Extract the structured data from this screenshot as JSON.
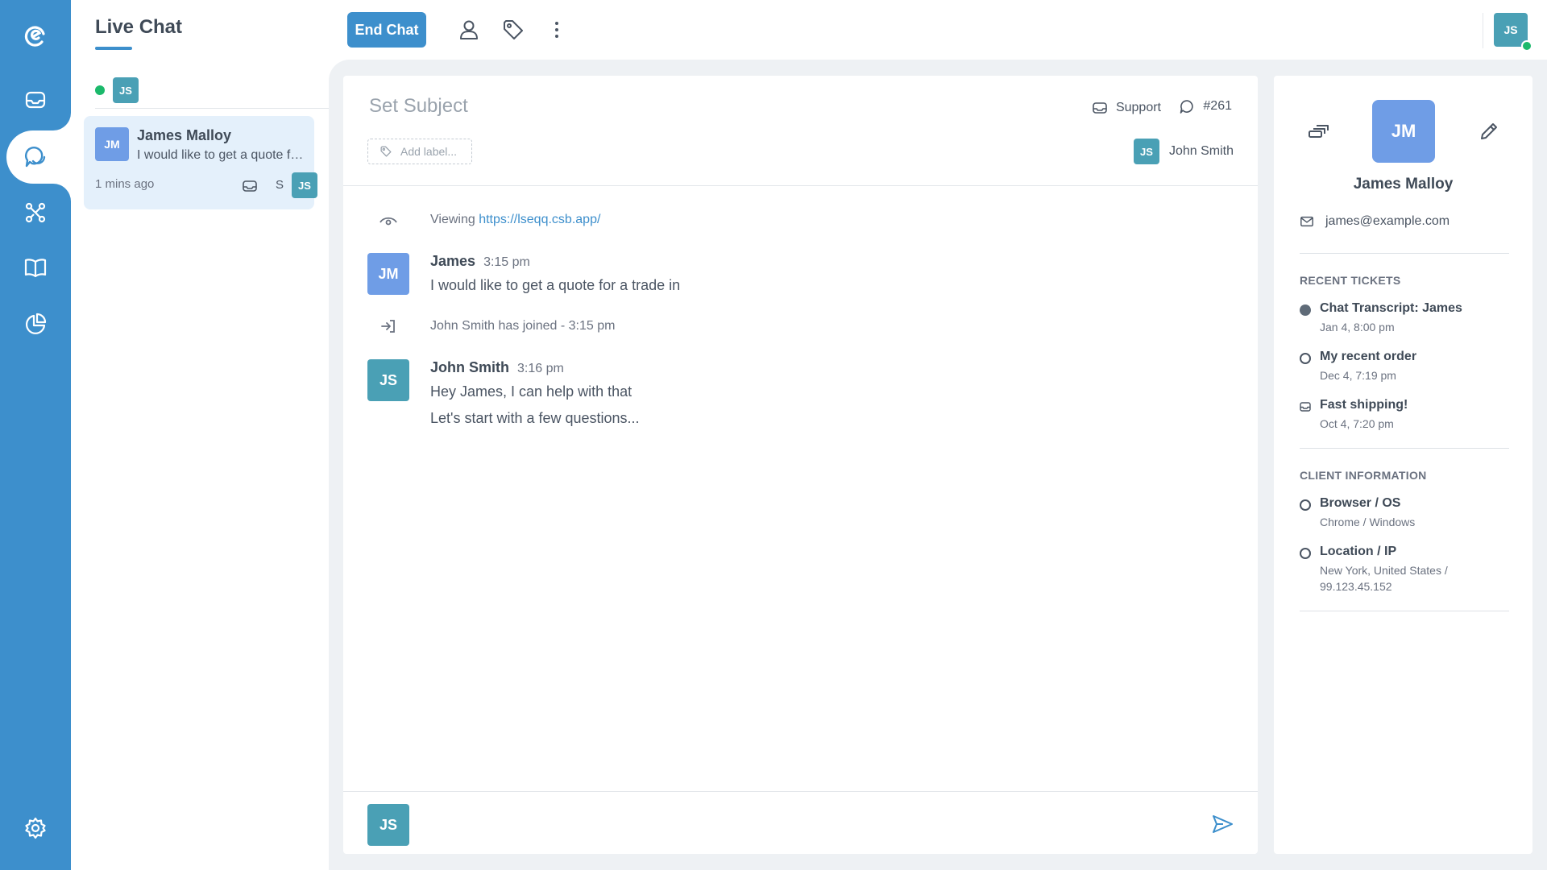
{
  "rail": {
    "items": [
      {
        "name": "logo-icon"
      },
      {
        "name": "inbox-icon"
      },
      {
        "name": "chat-icon"
      },
      {
        "name": "workflow-icon"
      },
      {
        "name": "knowledge-base-icon"
      },
      {
        "name": "reports-icon"
      },
      {
        "name": "settings-icon"
      }
    ],
    "accent": "#3d8fcc"
  },
  "chat_list": {
    "title": "Live Chat",
    "filter_agent_initials": "JS",
    "conversations": [
      {
        "initials": "JM",
        "name": "James Malloy",
        "preview": "I would like to get a quote for a trade in",
        "time": "1 mins ago",
        "inbox_letter": "S",
        "assignee_initials": "JS"
      }
    ]
  },
  "toolbar": {
    "end_chat_label": "End Chat",
    "current_user_initials": "JS"
  },
  "chat": {
    "subject_placeholder": "Set Subject",
    "add_label_text": "Add label...",
    "inbox_name": "Support",
    "ticket_number": "#261",
    "assignee_initials": "JS",
    "assignee_name": "John Smith",
    "viewing_prefix": "Viewing",
    "viewing_url": "https://lseqq.csb.app/",
    "messages": [
      {
        "initials": "JM",
        "author": "James",
        "time": "3:15 pm",
        "lines": [
          "I would like to get a quote for a trade in"
        ]
      },
      {
        "initials": "JS",
        "author": "John Smith",
        "time": "3:16 pm",
        "lines": [
          "Hey James, I can help with that",
          "Let's start with a few questions..."
        ]
      }
    ],
    "join_event": "John Smith has joined - 3:15 pm",
    "composer_initials": "JS",
    "composer_placeholder": ""
  },
  "contact": {
    "initials": "JM",
    "name": "James Malloy",
    "email": "james@example.com",
    "recent_tickets_title": "RECENT TICKETS",
    "tickets": [
      {
        "title": "Chat Transcript: James",
        "date": "Jan 4, 8:00 pm",
        "status_icon": "filled-dot"
      },
      {
        "title": "My recent order",
        "date": "Dec 4, 7:19 pm",
        "status_icon": "ring-dot"
      },
      {
        "title": "Fast shipping!",
        "date": "Oct 4, 7:20 pm",
        "status_icon": "inbox-icon"
      }
    ],
    "client_info_title": "CLIENT INFORMATION",
    "client_info": [
      {
        "title": "Browser / OS",
        "value": "Chrome / Windows"
      },
      {
        "title": "Location / IP",
        "value": "New York, United States / 99.123.45.152"
      }
    ]
  }
}
